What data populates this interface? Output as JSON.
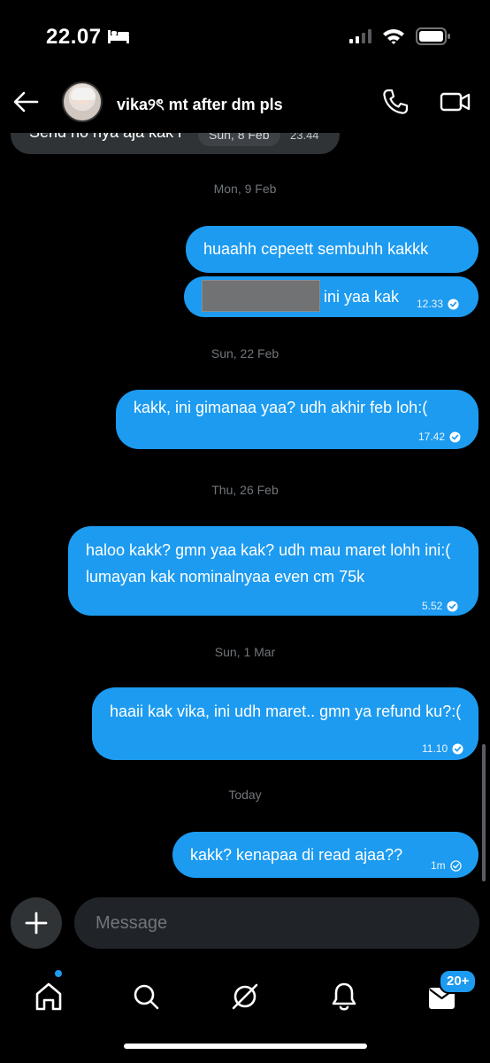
{
  "status_bar": {
    "time": "22.07"
  },
  "header": {
    "contact_name": "vika୨ৎ mt after dm pls"
  },
  "messages": [
    {
      "type": "incoming",
      "text": "Send no nya aja kak r",
      "date_chip": "Sun, 8 Feb",
      "time": "23.44"
    },
    {
      "type": "date",
      "text": "Mon, 9 Feb"
    },
    {
      "type": "outgoing",
      "text": "huaahh cepeett sembuhh kakkk"
    },
    {
      "type": "outgoing",
      "text": "ini yaa kak",
      "time": "12.33",
      "redacted": true
    },
    {
      "type": "date",
      "text": "Sun, 22 Feb"
    },
    {
      "type": "outgoing",
      "text": "kakk, ini gimanaa yaa? udh akhir feb loh:(",
      "time": "17.42"
    },
    {
      "type": "date",
      "text": "Thu, 26 Feb"
    },
    {
      "type": "outgoing",
      "text": "haloo kakk? gmn yaa kak? udh mau maret lohh ini:( lumayan kak nominalnyaa even cm 75k",
      "time": "5.52"
    },
    {
      "type": "date",
      "text": "Sun, 1 Mar"
    },
    {
      "type": "outgoing",
      "text": "haaii kak vika, ini udh maret.. gmn ya refund ku?:(",
      "time": "11.10"
    },
    {
      "type": "date",
      "text": "Today"
    },
    {
      "type": "outgoing",
      "text": "kakk? kenapaa di read ajaa??",
      "time": "1m",
      "status": "sent"
    }
  ],
  "composer": {
    "placeholder": "Message",
    "add_icon": "plus-icon"
  },
  "tabs": [
    {
      "name": "home",
      "icon": "home-icon",
      "has_dot": true
    },
    {
      "name": "search",
      "icon": "search-icon"
    },
    {
      "name": "grok",
      "icon": "grok-icon"
    },
    {
      "name": "notifications",
      "icon": "bell-icon"
    },
    {
      "name": "messages",
      "icon": "envelope-icon",
      "badge": "20+"
    }
  ],
  "colors": {
    "accent": "#1d9bf0",
    "incoming_bubble": "#2f3336",
    "background": "#000000",
    "muted_text": "#71767b"
  }
}
